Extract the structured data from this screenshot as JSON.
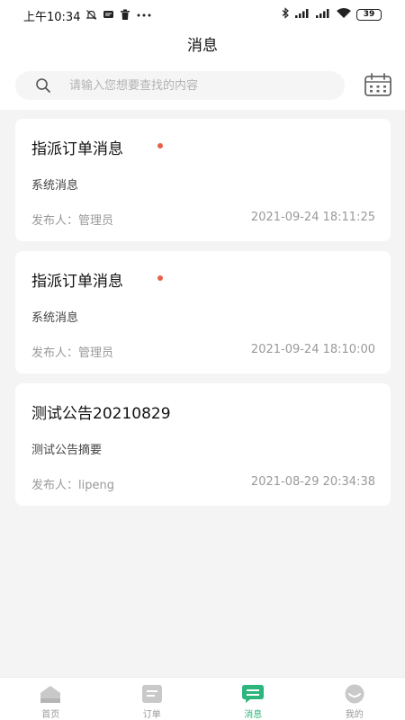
{
  "status_bar": {
    "time": "上午10:34",
    "battery": "39"
  },
  "header": {
    "title": "消息"
  },
  "search": {
    "placeholder": "请输入您想要查找的内容"
  },
  "messages": [
    {
      "title": "指派订单消息",
      "unread": true,
      "summary": "系统消息",
      "publisher": "发布人：管理员",
      "time": "2021-09-24 18:11:25"
    },
    {
      "title": "指派订单消息",
      "unread": true,
      "summary": "系统消息",
      "publisher": "发布人：管理员",
      "time": "2021-09-24 18:10:00"
    },
    {
      "title": "测试公告20210829",
      "unread": false,
      "summary": "测试公告摘要",
      "publisher": "发布人：lipeng",
      "time": "2021-08-29 20:34:38"
    }
  ],
  "tab_bar": {
    "tabs": [
      {
        "label": "首页",
        "icon": "home-icon",
        "active": false
      },
      {
        "label": "订单",
        "icon": "order-list-icon",
        "active": false
      },
      {
        "label": "消息",
        "icon": "message-icon",
        "active": true
      },
      {
        "label": "我的",
        "icon": "profile-icon",
        "active": false
      }
    ]
  },
  "colors": {
    "accent": "#2db67c",
    "unread_dot": "#e8604c",
    "background": "#f4f4f4"
  }
}
